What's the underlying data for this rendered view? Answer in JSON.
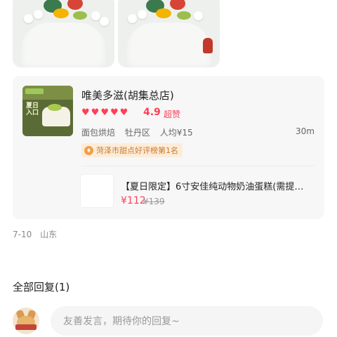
{
  "shop": {
    "name": "唯美多滋(胡集总店)",
    "hearts": [
      "heart-icon",
      "heart-icon",
      "heart-icon",
      "heart-icon",
      "heart-icon"
    ],
    "rating": "4.9",
    "rating_tag": "超赞",
    "category": "面包烘焙",
    "district": "牡丹区",
    "avg_price": "人均¥15",
    "distance": "30m",
    "rank_badge": "菏泽市甜点好评榜第1名",
    "thumb_text": "夏日入口"
  },
  "product": {
    "name": "【夏日限定】6寸安佳纯动物奶油蛋糕(需提…",
    "price": "¥112",
    "original_price": "¥139"
  },
  "post": {
    "date": "7-10",
    "location": "山东"
  },
  "replies": {
    "title": "全部回复(1)",
    "input_placeholder": "友善发言，期待你的回复~"
  },
  "colors": {
    "accent": "#ff3f55",
    "rank_text": "#c87a2a",
    "rank_bg": "#fdecd9",
    "card_bg": "#f7f7f7"
  }
}
